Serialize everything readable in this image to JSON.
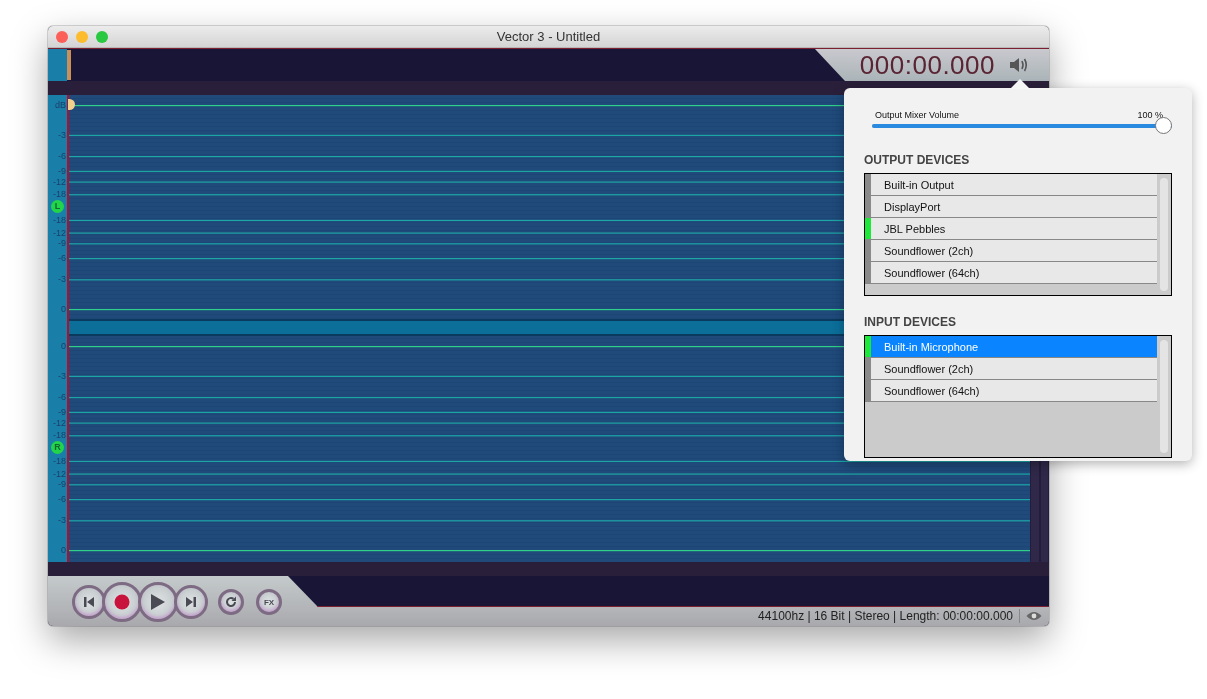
{
  "window": {
    "title": "Vector 3 - Untitled"
  },
  "timer": "000:00.000",
  "channels": [
    {
      "badge": "L",
      "scale": [
        "dB",
        "-3",
        "-6",
        "-9",
        "-12",
        "-18",
        "-18",
        "-12",
        "-9",
        "-6",
        "-3",
        "0"
      ]
    },
    {
      "badge": "R",
      "scale": [
        "0",
        "-3",
        "-6",
        "-9",
        "-12",
        "-18",
        "-18",
        "-12",
        "-9",
        "-6",
        "-3",
        "0"
      ]
    }
  ],
  "transport": [
    {
      "kind": "skip-back"
    },
    {
      "kind": "record"
    },
    {
      "kind": "play"
    },
    {
      "kind": "skip-forward"
    },
    {
      "kind": "loop"
    },
    {
      "kind": "fx",
      "label": "FX"
    }
  ],
  "status_bar": {
    "text": "44100hz | 16 Bit | Stereo | Length: 00:00:00.000"
  },
  "mixer_popover": {
    "volume": {
      "label": "Output Mixer Volume",
      "reading": "100 %",
      "level": 1
    },
    "output_devices": {
      "title": "OUTPUT DEVICES",
      "items": [
        {
          "name": "Built-in Output",
          "active": false,
          "selected": false
        },
        {
          "name": "DisplayPort",
          "active": false,
          "selected": false
        },
        {
          "name": "JBL Pebbles",
          "active": true,
          "selected": false
        },
        {
          "name": "Soundflower (2ch)",
          "active": false,
          "selected": false
        },
        {
          "name": "Soundflower (64ch)",
          "active": false,
          "selected": false
        }
      ]
    },
    "input_devices": {
      "title": "INPUT DEVICES",
      "items": [
        {
          "name": "Built-in Microphone",
          "active": true,
          "selected": true
        },
        {
          "name": "Soundflower (2ch)",
          "active": false,
          "selected": false
        },
        {
          "name": "Soundflower (64ch)",
          "active": false,
          "selected": false
        }
      ]
    }
  }
}
